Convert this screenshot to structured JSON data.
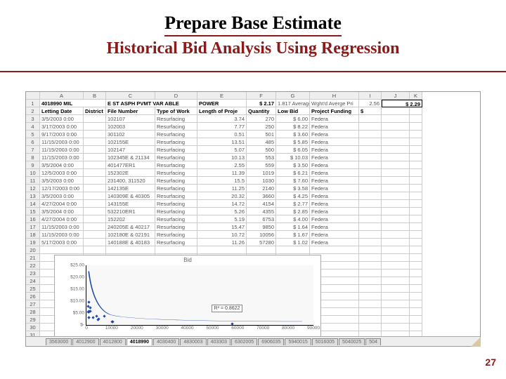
{
  "slide": {
    "title": "Prepare Base Estimate",
    "subtitle": "Historical Bid Analysis Using Regression",
    "page_number": "27"
  },
  "columns": [
    "A",
    "B",
    "C",
    "D",
    "E",
    "F",
    "G",
    "H",
    "I",
    "J",
    "K"
  ],
  "top_row": {
    "item": "4018990 MIL",
    "desc": "E  ST ASPH PVMT  VAR ABLE",
    "power_label": "POWER",
    "power_val": "$  2.17",
    "stats_left": "1.817 Average Pri",
    "stats_right_label": "Wght'd Averge Pri",
    "avg_val": "2.56",
    "boxed_val": "$   2.29"
  },
  "headers": {
    "letting": "Letting Date",
    "district": "District",
    "file": "File Number",
    "work": "Type of Work",
    "length": "Length of Proje",
    "qty": "Quantity",
    "lowbid": "Low Bid",
    "funding": "Project Funding",
    "s": "$"
  },
  "rows": [
    {
      "r": "3",
      "d": "3/5/2003 0:00",
      "dist": "",
      "file": "102107",
      "work": "Resurfacing",
      "len": "3.74",
      "qty": "270",
      "low": "$ 6.00",
      "fund": "Federa"
    },
    {
      "r": "4",
      "d": "3/17/2003 0:00",
      "dist": "",
      "file": "102003",
      "work": "Resurfacing",
      "len": "7.77",
      "qty": "250",
      "low": "$ 8.22",
      "fund": "Federa"
    },
    {
      "r": "5",
      "d": "9/17/2003 0:00",
      "dist": "",
      "file": "301102",
      "work": "Resurfacing",
      "len": "0.51",
      "qty": "501",
      "low": "$ 3.60",
      "fund": "Federa"
    },
    {
      "r": "6",
      "d": "11/15/2003 0:00",
      "dist": "",
      "file": "102155E",
      "work": "Resurfacing",
      "len": "13.51",
      "qty": "485",
      "low": "$ 5.85",
      "fund": "Federa"
    },
    {
      "r": "7",
      "d": "11/15/2003 0:00",
      "dist": "",
      "file": "102147",
      "work": "Resurfacing",
      "len": "5.07",
      "qty": "500",
      "low": "$ 6.05",
      "fund": "Federa"
    },
    {
      "r": "8",
      "d": "11/15/2003 0:00",
      "dist": "",
      "file": "102345E & 21134",
      "work": "Resurfacing",
      "len": "10.13",
      "qty": "553",
      "low": "$ 10.03",
      "fund": "Federa"
    },
    {
      "r": "9",
      "d": "3/5/2004 0:00",
      "dist": "",
      "file": "401477ER1",
      "work": "Resurfacing",
      "len": "2.55",
      "qty": "559",
      "low": "$ 3.50",
      "fund": "Federa"
    },
    {
      "r": "10",
      "d": "12/5/2003 0:00",
      "dist": "",
      "file": "152302E",
      "work": "Resurfacing",
      "len": "11.39",
      "qty": "1019",
      "low": "$ 6.21",
      "fund": "Federa"
    },
    {
      "r": "11",
      "d": "3/5/2003 0:00",
      "dist": "",
      "file": "231400, 311520",
      "work": "Resurfacing",
      "len": "15.5",
      "qty": "1030",
      "low": "$ 7.60",
      "fund": "Federa"
    },
    {
      "r": "12",
      "d": "12/17/2003 0:00",
      "dist": "",
      "file": "142135E",
      "work": "Resurfacing",
      "len": "11.25",
      "qty": "2140",
      "low": "$ 3.58",
      "fund": "Federa"
    },
    {
      "r": "13",
      "d": "3/5/2003 0:00",
      "dist": "",
      "file": "140309E & 40305",
      "work": "Resurfacing",
      "len": "20.32",
      "qty": "3660",
      "low": "$ 4.25",
      "fund": "Federa"
    },
    {
      "r": "14",
      "d": "4/27/2004 0:00",
      "dist": "",
      "file": "143155E",
      "work": "Resurfacing",
      "len": "14.72",
      "qty": "4154",
      "low": "$ 2.77",
      "fund": "Federa"
    },
    {
      "r": "15",
      "d": "3/5/2004 0:00",
      "dist": "",
      "file": "532210ER1",
      "work": "Resurfacing",
      "len": "5.26",
      "qty": "4355",
      "low": "$ 2.85",
      "fund": "Federa"
    },
    {
      "r": "16",
      "d": "4/27/2004 0:00",
      "dist": "",
      "file": "152202",
      "work": "Resurfacing",
      "len": "5.19",
      "qty": "6753",
      "low": "$ 4.00",
      "fund": "Federa"
    },
    {
      "r": "17",
      "d": "11/15/2003 0:00",
      "dist": "",
      "file": "240205E & 40217",
      "work": "Resurfacing",
      "len": "15.47",
      "qty": "9850",
      "low": "$ 1.64",
      "fund": "Federa"
    },
    {
      "r": "18",
      "d": "11/15/2003 0:00",
      "dist": "",
      "file": "102180E & 02191",
      "work": "Resurfacing",
      "len": "10.72",
      "qty": "10056",
      "low": "$ 1.67",
      "fund": "Federa"
    },
    {
      "r": "19",
      "d": "5/17/2003 0:00",
      "dist": "",
      "file": "140188E & 40183",
      "work": "Resurfacing",
      "len": "11.26",
      "qty": "57280",
      "low": "$ 1.02",
      "fund": "Federa"
    }
  ],
  "empty_rows": [
    "20",
    "21"
  ],
  "chart_data": {
    "type": "scatter",
    "title": "Bid",
    "ylabel": "",
    "xlabel": "",
    "ylim": [
      0,
      25
    ],
    "yticks": [
      "$25.00",
      "$20.00",
      "$15.00",
      "$10.00",
      "$5.00",
      "$-"
    ],
    "xlim": [
      0,
      90000
    ],
    "xticks": [
      "0",
      "10000",
      "20000",
      "30000",
      "40000",
      "50000",
      "60000",
      "70000",
      "80000",
      "90000"
    ],
    "r2_label": "R² = 0.8622",
    "series": [
      {
        "name": "Bid",
        "points": [
          [
            270,
            6.0
          ],
          [
            250,
            8.22
          ],
          [
            501,
            3.6
          ],
          [
            485,
            5.85
          ],
          [
            500,
            6.05
          ],
          [
            553,
            10.03
          ],
          [
            559,
            3.5
          ],
          [
            1019,
            6.21
          ],
          [
            1030,
            7.6
          ],
          [
            2140,
            3.58
          ],
          [
            3660,
            4.25
          ],
          [
            4154,
            2.77
          ],
          [
            4355,
            2.85
          ],
          [
            6753,
            4.0
          ],
          [
            9850,
            1.64
          ],
          [
            10056,
            1.67
          ],
          [
            57280,
            1.02
          ]
        ]
      }
    ]
  },
  "tabs": {
    "items": [
      "3563000",
      "4012900",
      "4012800",
      "4018990",
      "4030400",
      "4830003",
      "403303",
      "6302005",
      "6906035",
      "5940015",
      "5016005",
      "5040025",
      "504"
    ],
    "active_index": 3
  }
}
